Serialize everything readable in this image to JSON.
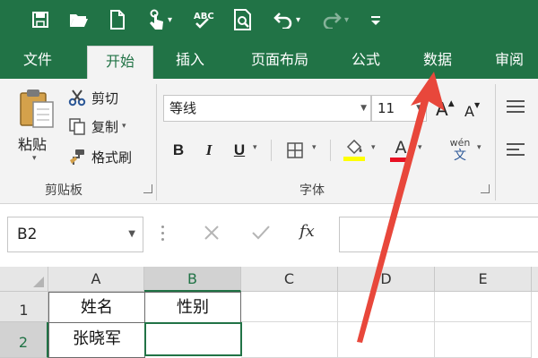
{
  "ribbon_tabs": [
    {
      "label": "文件"
    },
    {
      "label": "开始"
    },
    {
      "label": "插入"
    },
    {
      "label": "页面布局"
    },
    {
      "label": "公式"
    },
    {
      "label": "数据"
    },
    {
      "label": "审阅"
    }
  ],
  "active_tab": "开始",
  "clipboard": {
    "paste_label": "粘贴",
    "cut_label": "剪切",
    "copy_label": "复制",
    "format_painter_label": "格式刷",
    "group_label": "剪贴板"
  },
  "font": {
    "font_name": "等线",
    "font_size": "11",
    "bold": "B",
    "italic": "I",
    "underline": "U",
    "font_color_glyph": "A",
    "phonetic_glyph": "wén",
    "phonetic_sub": "文",
    "group_label": "字体",
    "grow_glyph": "A",
    "shrink_glyph": "A"
  },
  "formula_bar": {
    "name_box": "B2",
    "fx_label": "fx"
  },
  "sheet": {
    "columns": [
      "A",
      "B",
      "C",
      "D",
      "E"
    ],
    "selected_column": "B",
    "rows": [
      {
        "row": "1",
        "cells": [
          "姓名",
          "性别",
          "",
          "",
          ""
        ]
      },
      {
        "row": "2",
        "cells": [
          "张晓军",
          "",
          "",
          "",
          ""
        ]
      }
    ],
    "selected_row": "2",
    "active_cell": "B2"
  },
  "colors": {
    "brand_green": "#217346",
    "highlight_yellow": "#ffff00",
    "font_red": "#e81123",
    "annotation_red": "#e8473b"
  },
  "icons": [
    "save-icon",
    "open-icon",
    "new-icon",
    "touch-mode-icon",
    "spelling-icon",
    "print-preview-icon",
    "undo-icon",
    "redo-icon",
    "customize-qat-icon",
    "paste-icon",
    "scissors-icon",
    "copy-icon",
    "format-painter-icon",
    "borders-icon",
    "fill-color-icon",
    "font-color-icon",
    "cancel-icon",
    "enter-icon"
  ]
}
